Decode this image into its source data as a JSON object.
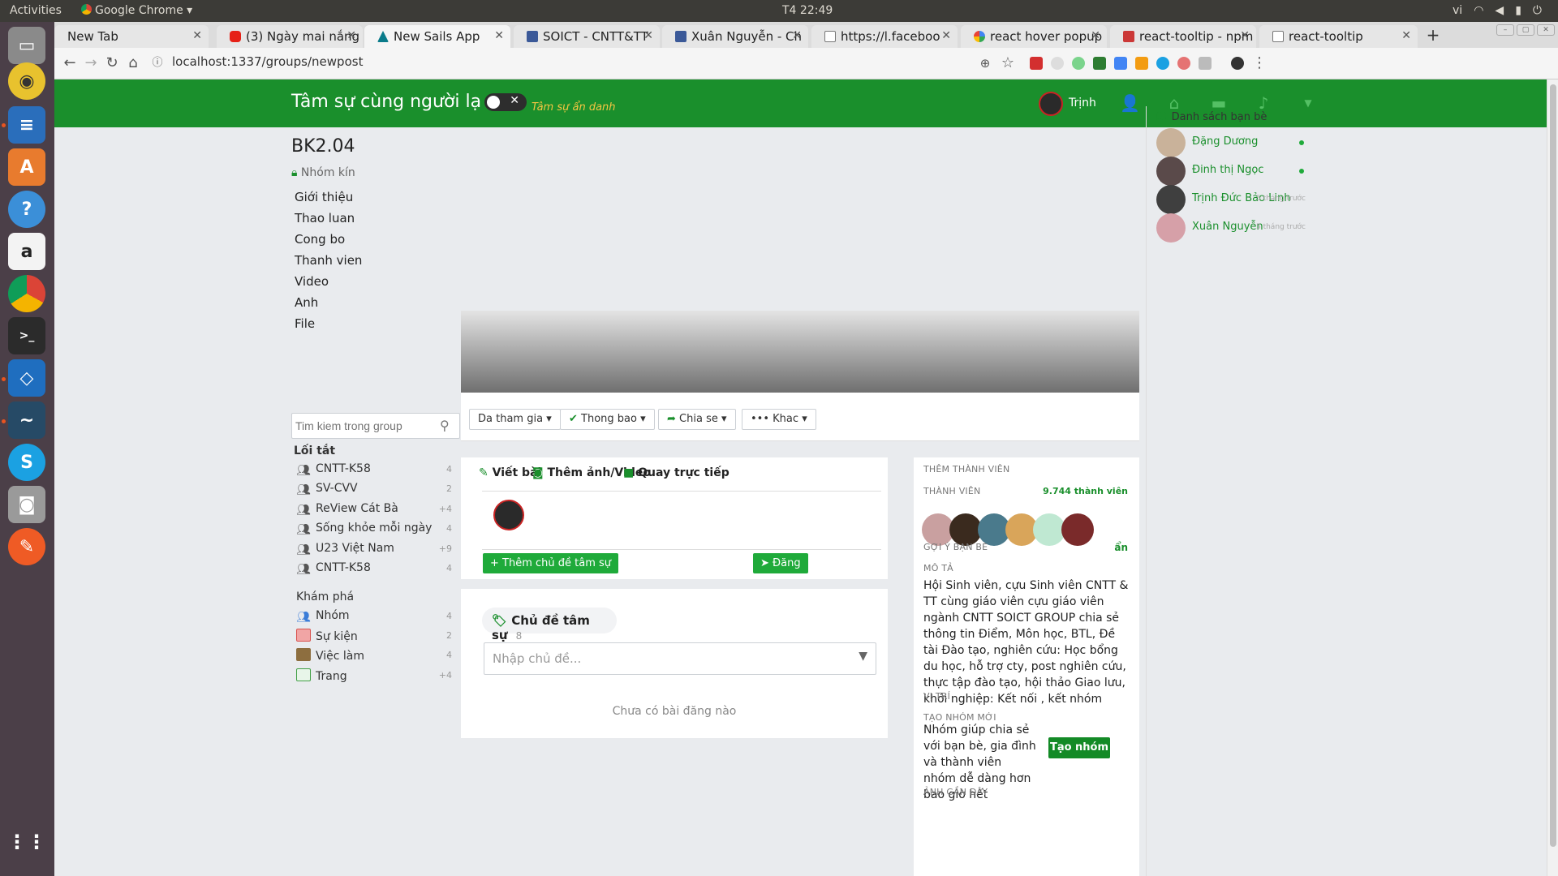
{
  "system": {
    "activities": "Activities",
    "app_name": "Google Chrome",
    "clock": "T4 22:49",
    "lang": "vi"
  },
  "tabs": [
    {
      "label": "New Tab",
      "icon": "none"
    },
    {
      "label": "(3) Ngày mai nắng",
      "icon": "youtube-icon"
    },
    {
      "label": "New Sails App",
      "icon": "sails-icon"
    },
    {
      "label": "SOICT - CNTT&TT",
      "icon": "facebook-icon"
    },
    {
      "label": "Xuân Nguyễn - Ch",
      "icon": "facebook-icon"
    },
    {
      "label": "https://l.faceboo",
      "icon": "page-icon"
    },
    {
      "label": "react hover popup",
      "icon": "google-icon"
    },
    {
      "label": "react-tooltip - npm",
      "icon": "npm-icon"
    },
    {
      "label": "react-tooltip",
      "icon": "page-icon"
    }
  ],
  "address_bar": {
    "url": "localhost:1337/groups/newpost"
  },
  "header": {
    "brand": "Tâm sự cùng người lạ",
    "anon_label": "Tâm sự ẩn danh",
    "user_name": "Trịnh"
  },
  "group": {
    "name": "BK2.04",
    "privacy": "Nhóm kín",
    "menu": [
      "Giới thiệu",
      "Thao luan",
      "Cong bo",
      "Thanh vien",
      "Video",
      "Anh",
      "File"
    ],
    "search_placeholder": "Tim kiem trong group"
  },
  "shortcuts": {
    "title": "Lối tắt",
    "items": [
      {
        "label": "CNTT-K58",
        "count": "4"
      },
      {
        "label": "SV-CVV",
        "count": "2"
      },
      {
        "label": "ReView Cát Bà",
        "count": "+4"
      },
      {
        "label": "Sống khỏe mỗi ngày",
        "count": "4"
      },
      {
        "label": "U23 Việt Nam",
        "count": "+9"
      },
      {
        "label": "CNTT-K58",
        "count": "4"
      }
    ]
  },
  "explore": {
    "title": "Khám phá",
    "items": [
      {
        "label": "Nhóm",
        "count": "4",
        "icon": "group-icon"
      },
      {
        "label": "Sự kiện",
        "count": "2",
        "icon": "calendar-icon"
      },
      {
        "label": "Việc làm",
        "count": "4",
        "icon": "briefcase-icon"
      },
      {
        "label": "Trang",
        "count": "+4",
        "icon": "page-icon"
      }
    ]
  },
  "actions": {
    "join": "Da tham gia",
    "notify": "Thong bao",
    "share": "Chia se",
    "other": "Khac"
  },
  "composer": {
    "tab_write": "Viết bài",
    "tab_photo": "Thêm ảnh/Video",
    "tab_live": "Quay trực tiếp",
    "add_topic": "Thêm chủ đề tâm sự",
    "post": "Đăng"
  },
  "topics": {
    "title": "Chủ đề tâm sự",
    "count": "8",
    "placeholder": "Nhập chủ đề...",
    "empty": "Chưa có bài đăng nào"
  },
  "info": {
    "add_members": "THÊM THÀNH VIÊN",
    "members_label": "THÀNH VIÊN",
    "members_count": "9.744 thành viên",
    "suggest_label": "GỢI Ý BẠN BÈ",
    "suggest_action": "ẩn",
    "desc_label": "MÔ TẢ",
    "desc": "Hội Sinh viên, cựu Sinh viên CNTT & TT cùng giáo viên cựu giáo viên ngành CNTT SOICT GROUP chia sẻ thông tin Điểm, Môn học, BTL, Đề tài Đào tạo, nghiên cứu: Học bổng du học, hỗ trợ cty, post nghiên cứu, thực tập đào tạo, hội thảo Giao lưu, khởi nghiệp: Kết nối , kết nhóm",
    "location_label": "VỊ TRÍ",
    "new_group_label": "TẠO NHÓM MỚI",
    "new_group_text": "Nhóm giúp chia sẻ với bạn bè, gia đình và thành viên nhóm dễ dàng hơn bao giờ hết",
    "create_button": "Tạo nhóm",
    "recent_photos_label": "ẢNH GẦN ĐÂY"
  },
  "friends": {
    "title": "Danh sách bạn bè",
    "items": [
      {
        "name": "Đặng Dương",
        "status": "",
        "online": true
      },
      {
        "name": "Đinh thị Ngọc",
        "status": "",
        "online": true
      },
      {
        "name": "Trịnh Đức Bảo Linh",
        "status": "5 tháng trước",
        "online": false
      },
      {
        "name": "Xuân Nguyễn",
        "status": "5 tháng trước",
        "online": false
      }
    ]
  },
  "colors": {
    "brand_green": "#1a8f2c",
    "button_green": "#1faa3a",
    "anon_yellow": "#f4c542"
  }
}
